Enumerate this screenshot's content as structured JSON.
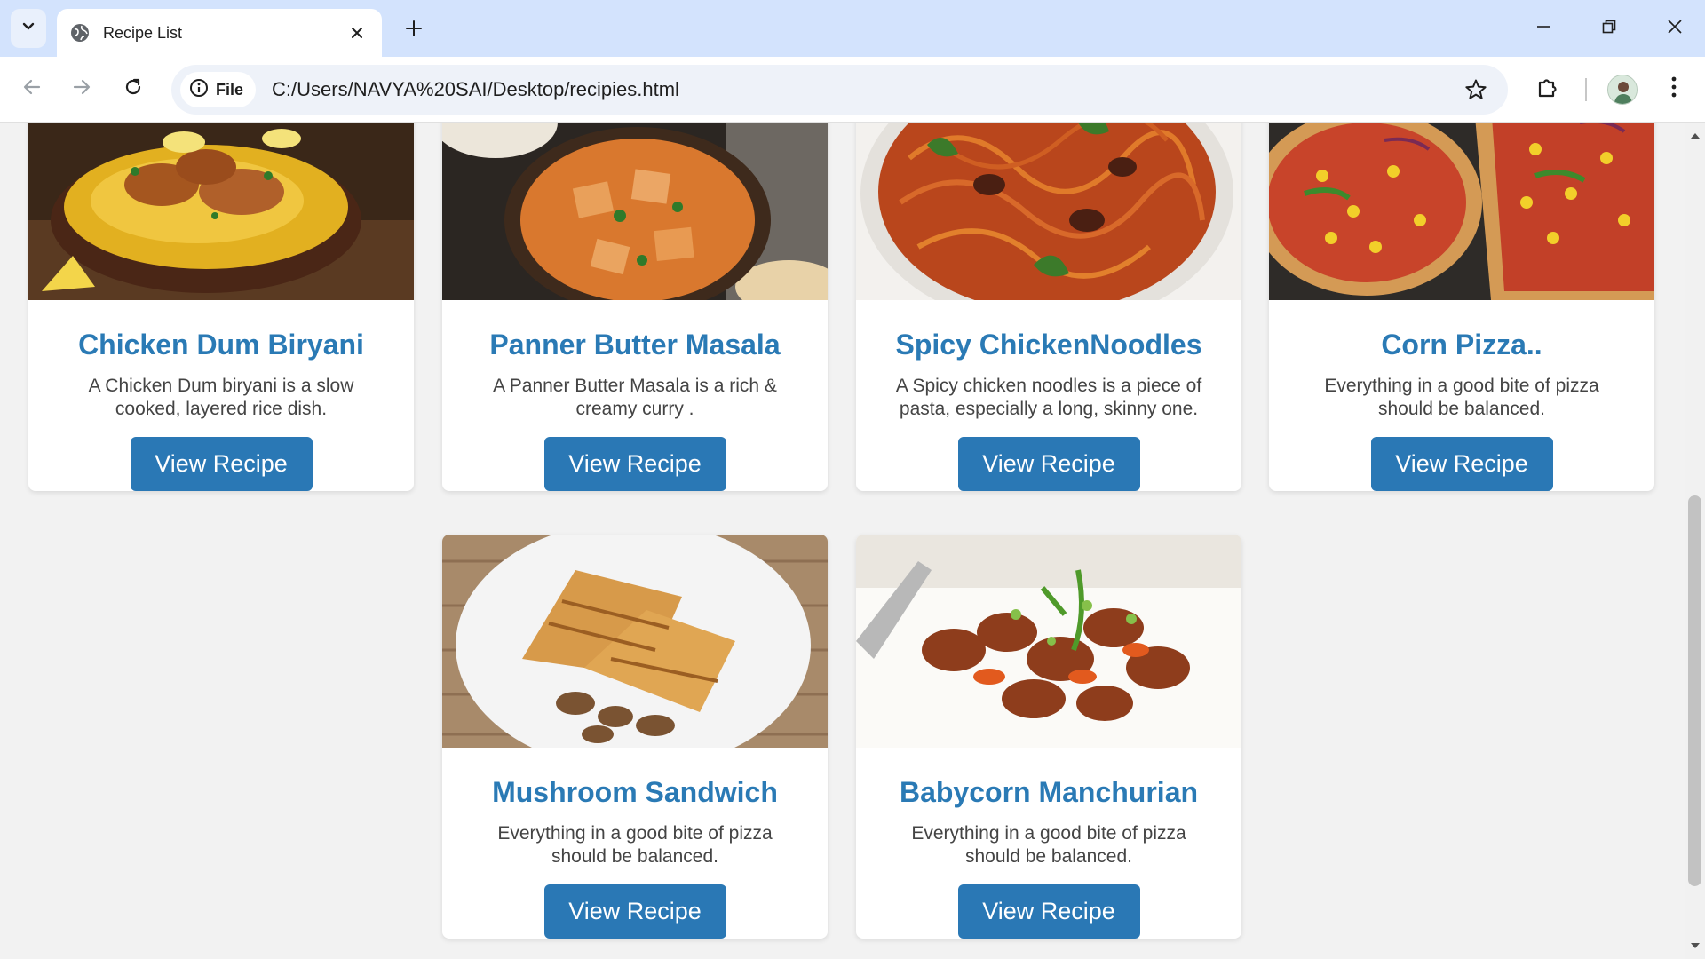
{
  "browser": {
    "tab_title": "Recipe List",
    "site_chip_label": "File",
    "url": "C:/Users/NAVYA%20SAI/Desktop/recipies.html"
  },
  "icons": {
    "tab_search": "chevron-down-icon",
    "favicon": "globe-icon",
    "tab_close": "close-icon",
    "new_tab": "plus-icon",
    "minimize": "minimize-icon",
    "restore": "restore-icon",
    "close_window": "close-icon",
    "back": "back-arrow-icon",
    "forward": "forward-arrow-icon",
    "reload": "reload-icon",
    "info": "info-icon",
    "bookmark": "star-icon",
    "extensions": "puzzle-icon",
    "menu": "more-vert-icon"
  },
  "colors": {
    "title": "#2a7ab5",
    "button": "#2a78b5",
    "tabbar": "#d3e3fd"
  },
  "recipes": [
    {
      "title": "Chicken Dum Biryani",
      "desc": "A Chicken Dum biryani is a slow cooked, layered rice dish.",
      "button": "View Recipe"
    },
    {
      "title": "Panner Butter Masala",
      "desc": "A Panner Butter Masala is a rich & creamy curry .",
      "button": "View Recipe"
    },
    {
      "title": "Spicy ChickenNoodles",
      "desc": "A Spicy chicken noodles is a piece of pasta, especially a long, skinny one.",
      "button": "View Recipe"
    },
    {
      "title": "Corn Pizza..",
      "desc": "Everything in a good bite of pizza should be balanced.",
      "button": "View Recipe"
    },
    {
      "title": "Mushroom Sandwich",
      "desc": "Everything in a good bite of pizza should be balanced.",
      "button": "View Recipe"
    },
    {
      "title": "Babycorn Manchurian",
      "desc": "Everything in a good bite of pizza should be balanced.",
      "button": "View Recipe"
    }
  ]
}
